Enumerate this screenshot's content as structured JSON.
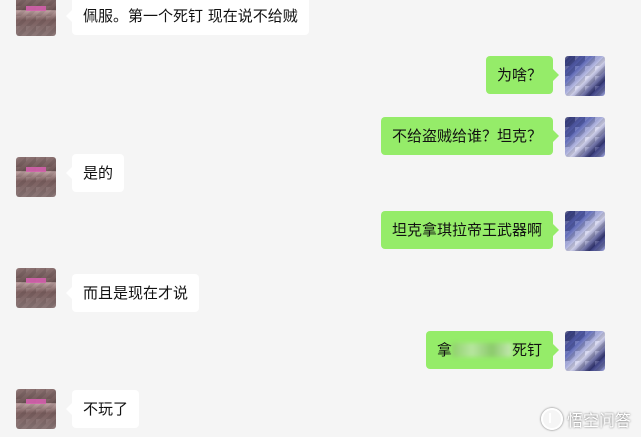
{
  "messages": [
    {
      "side": "in",
      "text": "佩服。第一个死钉 现在说不给贼"
    },
    {
      "side": "out",
      "text": "为啥？"
    },
    {
      "side": "out",
      "text": "不给盗贼给谁？坦克？"
    },
    {
      "side": "in",
      "text": "是的"
    },
    {
      "side": "out",
      "text": "坦克拿琪拉帝王武器啊"
    },
    {
      "side": "in",
      "text": "而且是现在才说"
    },
    {
      "side": "out",
      "text_before": "拿",
      "text_after": "死钉",
      "text_redacted": true
    },
    {
      "side": "in",
      "text": "不玩了"
    }
  ],
  "watermark": {
    "text": "悟空问答",
    "icon": "wukong-logo-icon"
  },
  "colors": {
    "background": "#f5f5f5",
    "incoming_bubble": "#ffffff",
    "outgoing_bubble": "#95ec69"
  }
}
